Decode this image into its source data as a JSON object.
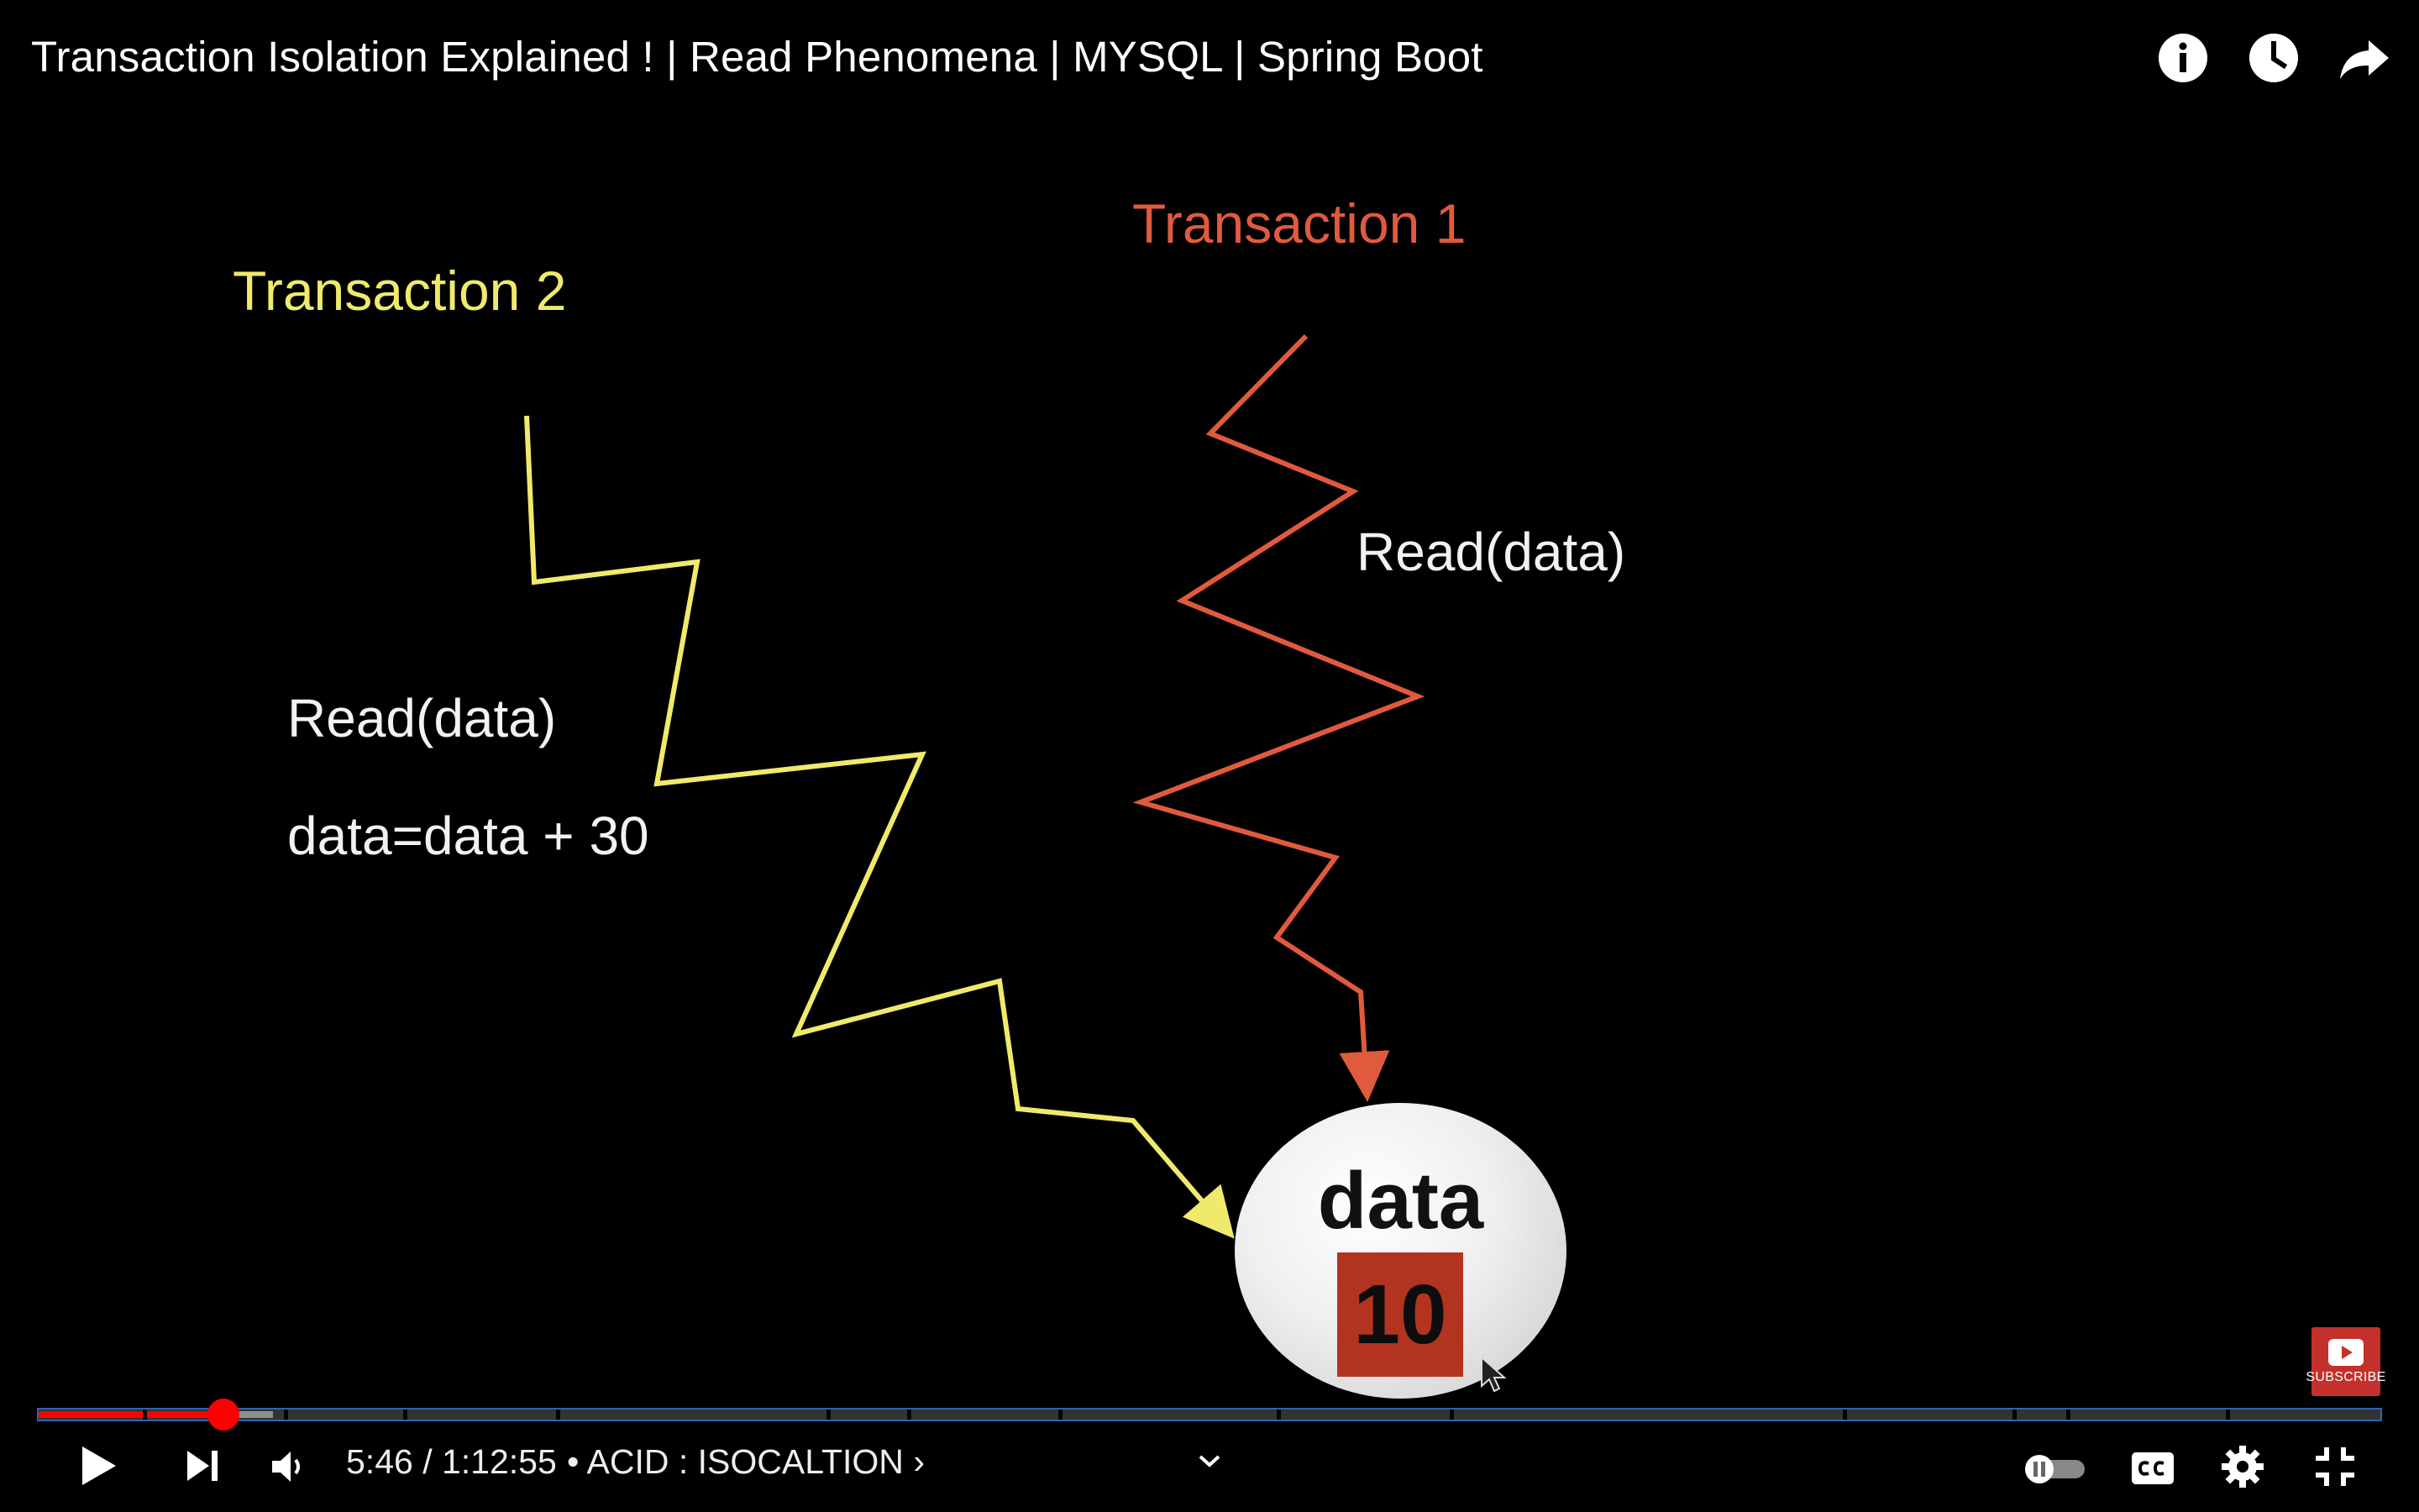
{
  "video": {
    "title": "Transaction Isolation Explained ! | Read Phenomena | MYSQL | Spring Boot"
  },
  "top_icons": [
    "info-icon",
    "watch-later-clock-icon",
    "share-arrow-icon"
  ],
  "slide": {
    "transaction_2_label": "Transaction 2",
    "transaction_1_label": "Transaction 1",
    "t1_step": "Read(data)",
    "t2_step_read": "Read(data)",
    "t2_step_update": "data=data + 30",
    "data_label": "data",
    "data_value": "10",
    "colors": {
      "transaction_2": "#f0ea6c",
      "transaction_1": "#e05a3e",
      "data_box": "#b33321"
    }
  },
  "subscribe_watermark": {
    "label": "SUBSCRIBE"
  },
  "player": {
    "current_time": "5:46",
    "duration": "1:12:55",
    "time_display": "5:46 / 1:12:55",
    "chapter_separator": "•",
    "chapter_title": "ACID : ISOCALTION",
    "chapter_chevron": "›",
    "progress_fraction": 0.079,
    "buffered_fraction": 0.1,
    "accent_color": "#ff0000",
    "autoplay_on": false,
    "controls": [
      "play-icon",
      "next-icon",
      "volume-icon",
      "expand-chevron-icon",
      "autoplay-toggle",
      "captions-icon",
      "settings-gear-icon",
      "exit-fullscreen-icon"
    ]
  }
}
